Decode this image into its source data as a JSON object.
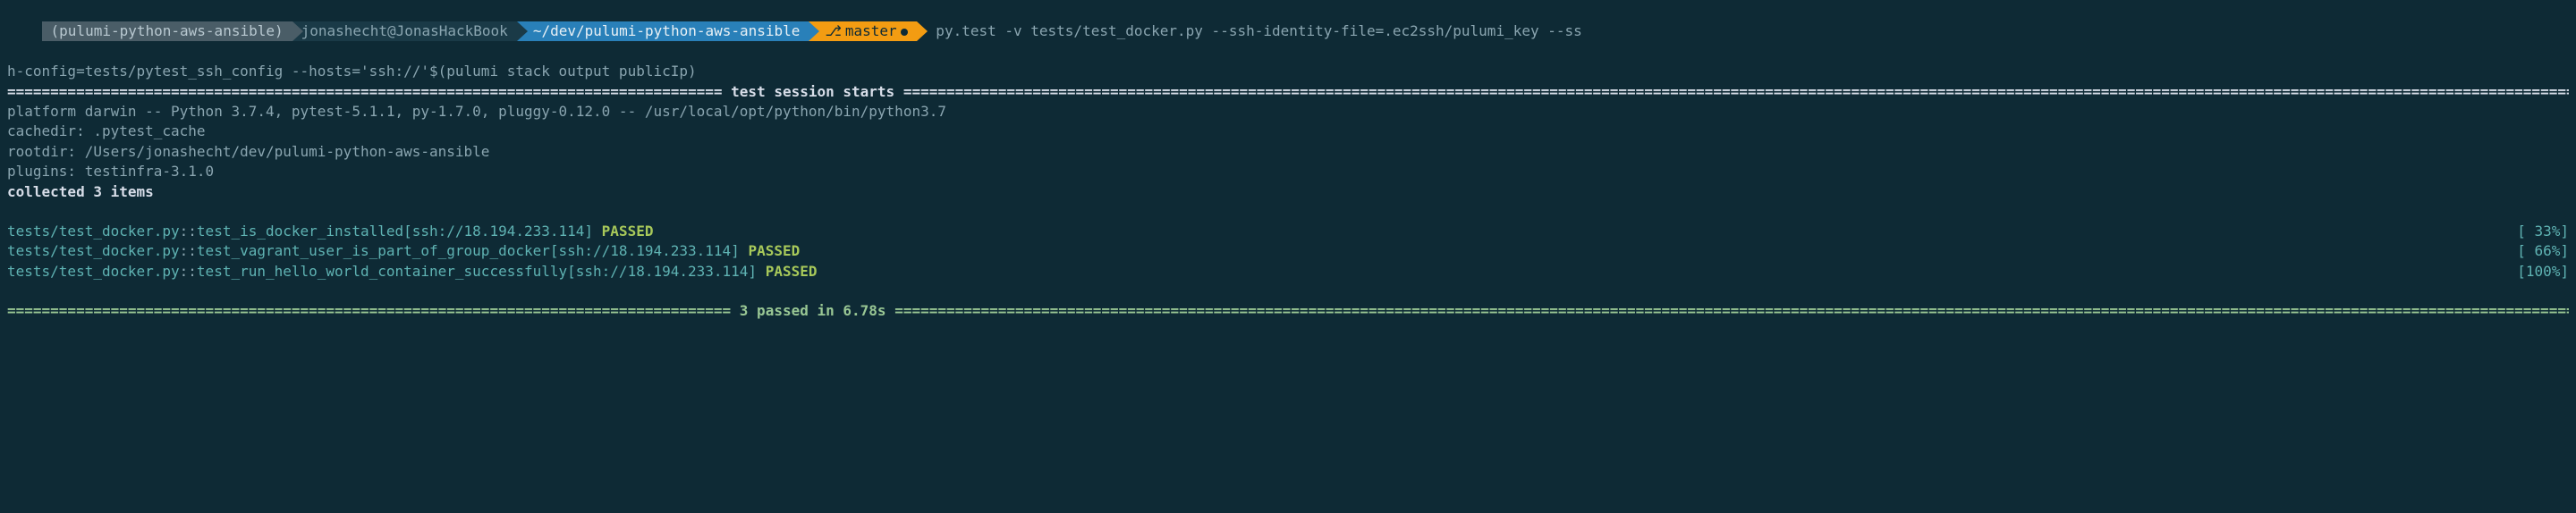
{
  "prompt": {
    "env": "(pulumi-python-aws-ansible)",
    "user_host": "jonashecht@JonasHackBook",
    "path": "~/dev/pulumi-python-aws-ansible",
    "branch": "master",
    "command_line1": " py.test -v tests/test_docker.py --ssh-identity-file=.ec2ssh/pulumi_key --ss",
    "command_line2": "h-config=tests/pytest_ssh_config --hosts='ssh://'$(pulumi stack output publicIp)"
  },
  "session_header": {
    "title": " test session starts ",
    "platform": "platform darwin -- Python 3.7.4, pytest-5.1.1, py-1.7.0, pluggy-0.12.0 -- /usr/local/opt/python/bin/python3.7",
    "cachedir": "cachedir: .pytest_cache",
    "rootdir": "rootdir: /Users/jonashecht/dev/pulumi-python-aws-ansible",
    "plugins": "plugins: testinfra-3.1.0",
    "collected": "collected 3 items"
  },
  "tests": [
    {
      "path": "tests/test_docker.py",
      "sep": "::",
      "name": "test_is_docker_installed[ssh://18.194.233.114]",
      "status": "PASSED",
      "pct": "[ 33%]"
    },
    {
      "path": "tests/test_docker.py",
      "sep": "::",
      "name": "test_vagrant_user_is_part_of_group_docker[ssh://18.194.233.114]",
      "status": "PASSED",
      "pct": "[ 66%]"
    },
    {
      "path": "tests/test_docker.py",
      "sep": "::",
      "name": "test_run_hello_world_container_successfully[ssh://18.194.233.114]",
      "status": "PASSED",
      "pct": "[100%]"
    }
  ],
  "footer": {
    "summary": " 3 passed in 6.78s "
  },
  "divider_left": "===================================================================================",
  "divider_right_long": "=========================================================================================================================================================================================================",
  "divider_footer_left": "====================================================================================",
  "divider_footer_right": "==========================================================================================================================================================================================================="
}
